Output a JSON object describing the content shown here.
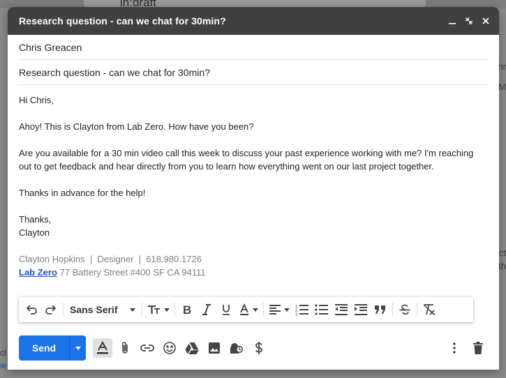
{
  "background": {
    "search_text": "in:draft",
    "right_fragments": [
      "hr",
      "M",
      "ct",
      "th"
    ],
    "left_fragments": [
      "cl",
      "w"
    ]
  },
  "compose": {
    "title": "Research question - can we chat for 30min?",
    "to": "Chris Greacen",
    "subject": "Research question - can we chat for 30min?",
    "body": {
      "greeting": "Hi Chris,",
      "line1": "Ahoy! This is Clayton from Lab Zero. How have you been?",
      "para2_line1": "Are you available for a 30 min video call this week to discuss your past experience working with me? I'm reaching",
      "para2_line2": "out to get feedback and hear directly from you to learn how everything went on our last project together.",
      "line3": "Thanks in advance for the help!",
      "closing": "Thanks,",
      "name": "Clayton"
    },
    "signature": {
      "line1": "Clayton Hopkins  |  Designer  |  618.980.1726",
      "link": "Lab Zero",
      "address": " 77 Battery Street #400 SF CA 94111"
    },
    "format_toolbar": {
      "font": "Sans Serif"
    },
    "send_label": "Send"
  },
  "colors": {
    "titlebar": "#404040",
    "send": "#1a73e8",
    "link": "#1a55c4"
  }
}
